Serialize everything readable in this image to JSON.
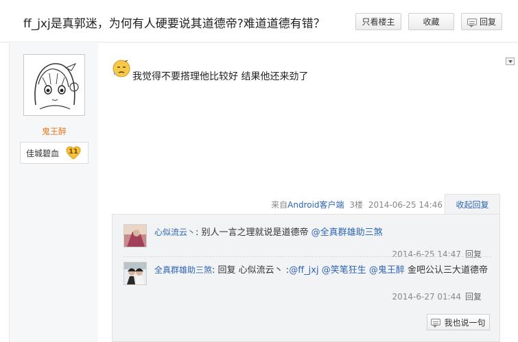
{
  "thread": {
    "title": "ff_jxj是真郭迷，为何有人硬要说其道德帝?难道道德有错？"
  },
  "toolbar": {
    "only_op_label": "只看楼主",
    "favorite_label": "收藏",
    "reply_label": "回复"
  },
  "author": {
    "name": "鬼王醉",
    "fan_title": "佳城碧血",
    "level": "11"
  },
  "post": {
    "emoji_icon": "sweat-face-icon",
    "text": "我觉得不要搭理他比较好 结果他还来劲了",
    "source_prefix": "来自",
    "source_client": "Android客户端",
    "floor": "3楼",
    "time": "2014-06-25 14:46",
    "collapse_label": "收起回复"
  },
  "replies": [
    {
      "user": "心似流云丶",
      "sep": ": ",
      "text": "别人一言之理就说是道德帝 ",
      "mention": "@全真群雄助三煞",
      "time": "2014-6-25 14:47",
      "reply_label": "回复"
    },
    {
      "user": "全真群雄助三煞",
      "sep": ": ",
      "prefix": "回复 心似流云丶 :",
      "mention1": "@ff_jxj",
      "mention2": "@笑笔狂生",
      "mention3": "@鬼王醉",
      "text": " 金吧公认三大道德帝",
      "time": "2014-6-27 01:44",
      "reply_label": "回复"
    }
  ],
  "say_button_label": "我也说一句",
  "colors": {
    "link": "#2d64b3",
    "author": "#e8761c",
    "panel": "#f2f3f5"
  }
}
